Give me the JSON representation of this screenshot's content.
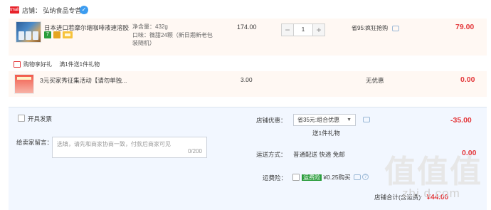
{
  "store": {
    "logo_text": "tmall",
    "label": "店铺：",
    "name": "弘纳食品专营店",
    "chat_icon": "wangwang-chat-icon"
  },
  "item": {
    "title": "日本进口若摩尔缩咖啡液速溶胶...",
    "badges": [
      {
        "text": "7",
        "color": "#2a9d3c",
        "icon": "seven-day-return-icon"
      },
      {
        "text": "",
        "color": "#e5a521",
        "icon": "credit-card-icon"
      }
    ],
    "sku_lines": [
      "净含量：432g",
      "口味：微甜24颗（新日期新老包",
      "装随机）"
    ],
    "unit_price": "174.00",
    "quantity": "1",
    "decrement_label": "−",
    "increment_label": "+",
    "promo": "省95:疯狂抢购",
    "subtotal": "79.00"
  },
  "gift": {
    "header": "购物享好礼",
    "rule": "满1件送1件礼物",
    "title": "3元买家秀征集活动【请勿单独...",
    "price": "3.00",
    "discount": "无优惠",
    "subtotal": "0.00"
  },
  "summary": {
    "invoice_label": "开具发票",
    "message_label": "给卖家留言：",
    "message_placeholder": "选填，请先和商家协商一致，付款后商家可见",
    "message_count": "0/200",
    "coupon_label": "店铺优惠：",
    "coupon_value": "省35元:组合优惠",
    "coupon_note": "送1件礼物",
    "coupon_amount": "-35.00",
    "shipping_label": "运送方式：",
    "shipping_value": "普通配送 快递 免邮",
    "shipping_amount": "0.00",
    "insurance_label": "运费险：",
    "insurance_badge": "运费险",
    "insurance_value": "¥0.25购买",
    "total_label": "店铺合计(含运费)",
    "total_amount": "¥44.00"
  },
  "watermark": {
    "big": "值值值",
    "small": "zhi.d.com"
  },
  "colors": {
    "accent_red": "#e4393c",
    "row_bg": "#fff8f3",
    "summary_bg": "#f2f7ff",
    "insurance_green": "#2a9d3c"
  }
}
